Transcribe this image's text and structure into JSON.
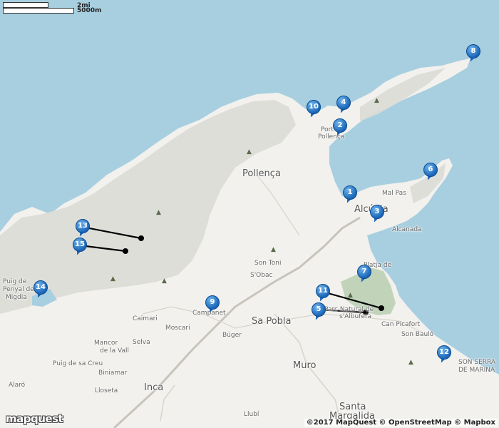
{
  "scale": {
    "miles_label": "2mi",
    "km_label": "5000m"
  },
  "logo_text": "mapquest",
  "attribution": "©2017 MapQuest © OpenStreetMap © Mapbox",
  "colors": {
    "water": "#a8cfe0",
    "land": "#f2f1ed",
    "mountain": "#dcdcd6",
    "park": "#b9cfb0",
    "pin": "#1a66b8",
    "route": "#000000"
  },
  "places": {
    "pollenca": "Pollença",
    "port_pollenca_1": "Port",
    "port_pollenca_2": "Pollença",
    "alcudia": "Alcúdia",
    "mal_pas": "Mal Pas",
    "alcanada": "Alcanada",
    "son_toni": "Son Toni",
    "s_obac": "S'Obac",
    "platja_de_1": "Platja de",
    "parc_natural_1": "Parc Natural de",
    "parc_natural_2": "s'Albufera",
    "can_picafort": "Can Picafort",
    "son_baulo": "Son Bauló",
    "son_serra_1": "SON SERRA",
    "son_serra_2": "DE MARINA",
    "campanet": "Campanet",
    "sa_pobla": "Sa Pobla",
    "buger": "Búger",
    "caimari": "Caimari",
    "moscari": "Moscari",
    "selva": "Selva",
    "mancor_1": "Mancor",
    "mancor_2": "de la Vall",
    "puig_de_sa_creu": "Puig de sa Creu",
    "biniamar": "Biniamar",
    "lloseta": "Lloseta",
    "inca": "Inca",
    "muro": "Muro",
    "santa_margalida_1": "Santa",
    "santa_margalida_2": "Margalida",
    "llubi": "Llubí",
    "alaro": "Alaró",
    "puig_de_1": "Puig de",
    "puig_de_2": "Penyal de",
    "puig_de_3": "Migdia"
  },
  "pins": [
    {
      "id": "1",
      "label": "1"
    },
    {
      "id": "2",
      "label": "2"
    },
    {
      "id": "3",
      "label": "3"
    },
    {
      "id": "4",
      "label": "4"
    },
    {
      "id": "5",
      "label": "5"
    },
    {
      "id": "6",
      "label": "6"
    },
    {
      "id": "7",
      "label": "7"
    },
    {
      "id": "8",
      "label": "8"
    },
    {
      "id": "9",
      "label": "9"
    },
    {
      "id": "10",
      "label": "10"
    },
    {
      "id": "11",
      "label": "11"
    },
    {
      "id": "12",
      "label": "12"
    },
    {
      "id": "13",
      "label": "13"
    },
    {
      "id": "14",
      "label": "14"
    },
    {
      "id": "15",
      "label": "15"
    }
  ]
}
